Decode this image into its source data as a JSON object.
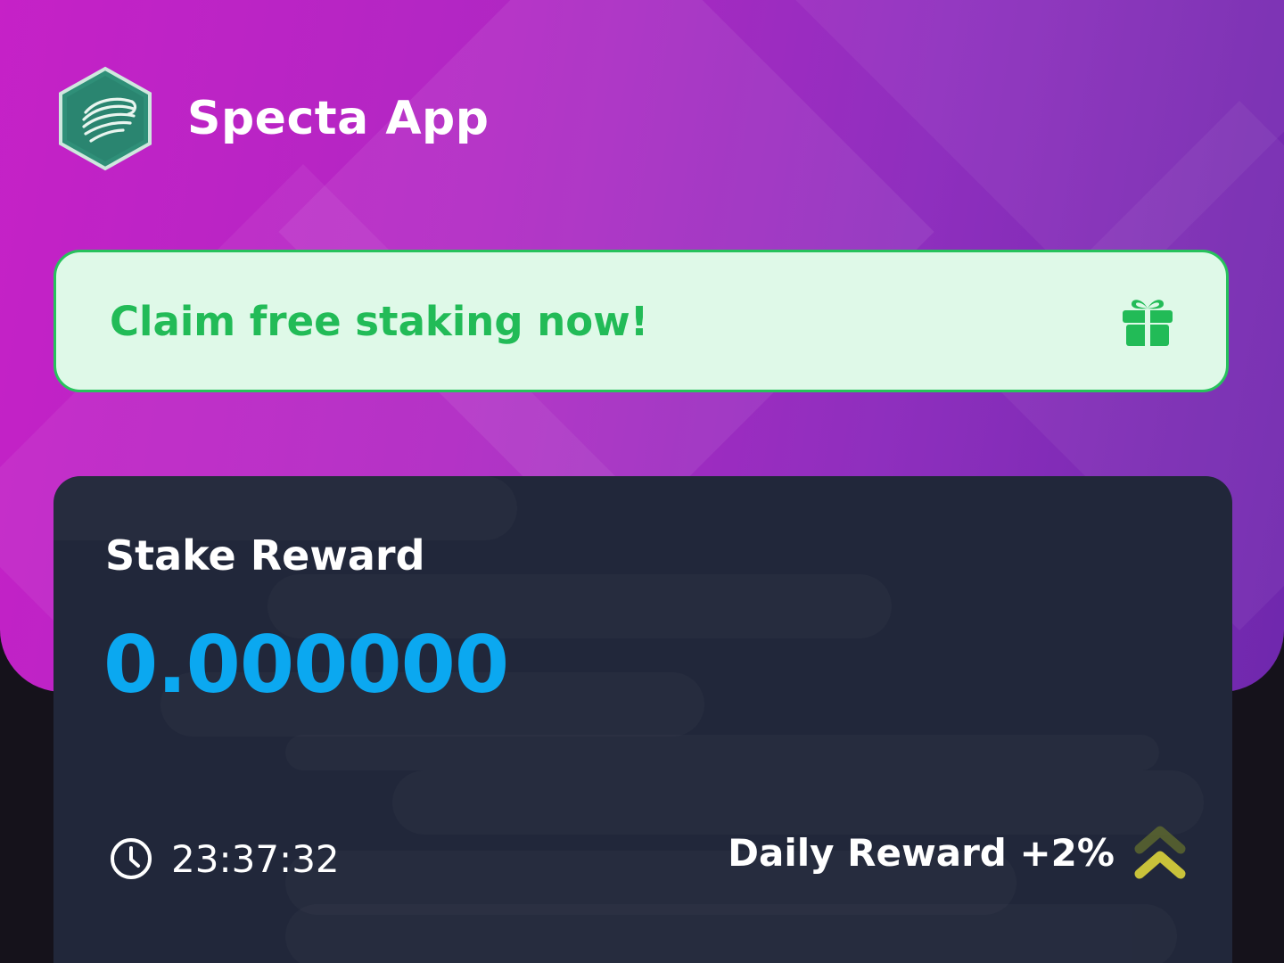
{
  "header": {
    "app_title": "Specta App",
    "logo_icon": "specta-hexagon-logo-icon"
  },
  "claim_banner": {
    "text": "Claim free staking now!",
    "icon": "gift-icon"
  },
  "stake_card": {
    "title": "Stake Reward",
    "value": "0.000000",
    "timer": "23:37:32",
    "timer_icon": "clock-icon",
    "daily_reward": "Daily Reward +2%",
    "daily_reward_icon": "double-chevron-up-icon"
  },
  "colors": {
    "hero_gradient_start": "#c621c7",
    "hero_gradient_end": "#6f28ad",
    "banner_bg": "#dff9e8",
    "banner_accent": "#22bb57",
    "card_bg": "#21273a",
    "value_blue": "#0ba8f0",
    "chevron_yellow": "#d8c93a",
    "logo_teal": "#2f8f78"
  }
}
